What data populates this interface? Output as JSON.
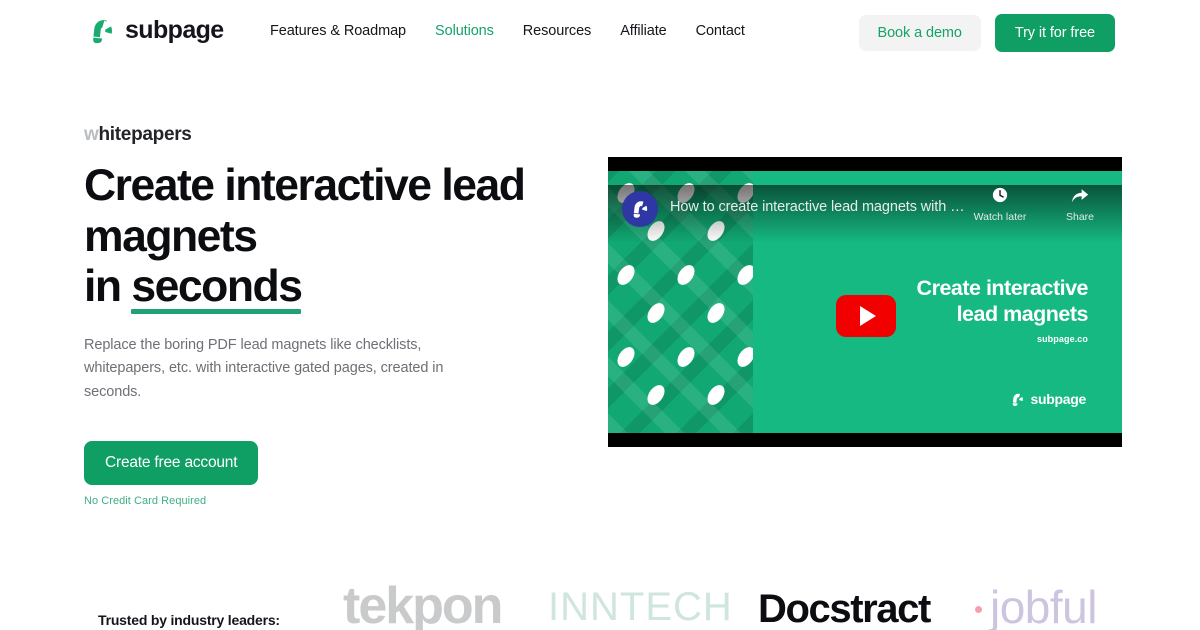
{
  "brand": {
    "name": "subpage",
    "logo_icon": "magnet-icon",
    "accent_green": "#0f9e63",
    "link_green": "#15a36a",
    "underline_green": "#21a276"
  },
  "nav": {
    "items": [
      {
        "label": "Features & Roadmap",
        "active": false
      },
      {
        "label": "Solutions",
        "active": true
      },
      {
        "label": "Resources",
        "active": false
      },
      {
        "label": "Affiliate",
        "active": false
      },
      {
        "label": "Contact",
        "active": false
      }
    ],
    "secondary_button": "Book a demo",
    "primary_button": "Try it for free"
  },
  "hero": {
    "eyebrow_first_char": "w",
    "eyebrow_rest": "hitepapers",
    "headline_line1": "Create interactive lead",
    "headline_line2": "magnets",
    "headline_line3_prefix": "in ",
    "headline_line3_underlined": "seconds",
    "subtitle_line1": "Replace the boring PDF lead magnets like checklists, whitepapers,",
    "subtitle_line2": "etc. with interactive gated pages, created in seconds.",
    "cta_label": "Create free account",
    "cta_note": "No Credit Card Required"
  },
  "video": {
    "channel_avatar_icon": "magnet-icon",
    "title": "How to create interactive lead magnets with …",
    "watch_later_label": "Watch later",
    "watch_later_icon": "clock-icon",
    "share_label": "Share",
    "share_icon": "share-arrow-icon",
    "play_icon": "youtube-play-icon",
    "thumbnail_heading_line1": "Create interactive",
    "thumbnail_heading_line2": "lead magnets",
    "thumbnail_site": "subpage.co",
    "thumbnail_brand": "subpage",
    "thumbnail_brand_icon": "magnet-icon",
    "background_green": "#15b981"
  },
  "logos": {
    "label": "Trusted by industry leaders:",
    "items": [
      {
        "name": "tekpon",
        "color": "#c9cacb"
      },
      {
        "name": "INNTECH",
        "color": "#cfe5dd"
      },
      {
        "name": "Docstract",
        "color": "#0c0d10"
      },
      {
        "name": "jobful",
        "color": "#cdc5e0"
      }
    ]
  }
}
